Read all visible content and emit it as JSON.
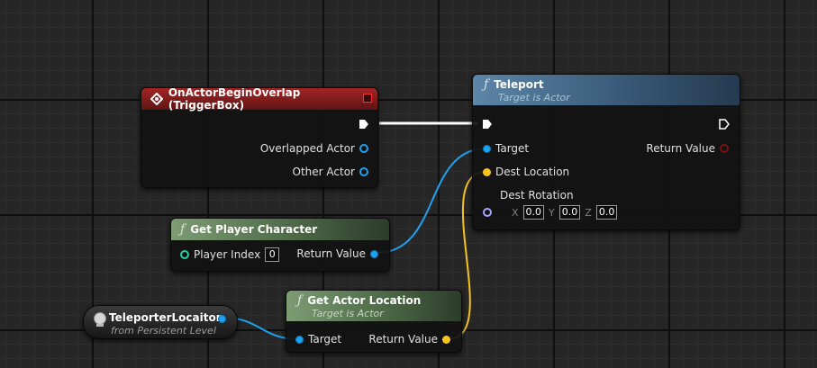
{
  "colors": {
    "event_header": "#a32626",
    "function_header": "#3a5a78",
    "pure_header": "#4e6a48",
    "object_wire": "#1ea2f0",
    "vector_wire": "#f6c51c",
    "exec_wire": "#ffffff"
  },
  "icons": {
    "event": "diamond-event-icon",
    "function": "function-f-icon",
    "variable": "globe-icon"
  },
  "event_node": {
    "title": "OnActorBeginOverlap (TriggerBox)",
    "pins": [
      "Overlapped Actor",
      "Other Actor"
    ]
  },
  "teleport_node": {
    "title": "Teleport",
    "subtitle": "Target is Actor",
    "target_label": "Target",
    "dest_location_label": "Dest Location",
    "dest_rotation_label": "Dest Rotation",
    "return_label": "Return Value",
    "rot": {
      "x_label": "X",
      "x": "0.0",
      "y_label": "Y",
      "y": "0.0",
      "z_label": "Z",
      "z": "0.0"
    }
  },
  "player_node": {
    "title": "Get Player Character",
    "player_index_label": "Player Index",
    "player_index_value": "0",
    "return_label": "Return Value"
  },
  "location_node": {
    "title": "Get Actor Location",
    "subtitle": "Target is Actor",
    "target_label": "Target",
    "return_label": "Return Value"
  },
  "variable_node": {
    "title": "TeleporterLocaiton",
    "subtitle": "from Persistent Level"
  },
  "function_glyph": "ƒ"
}
